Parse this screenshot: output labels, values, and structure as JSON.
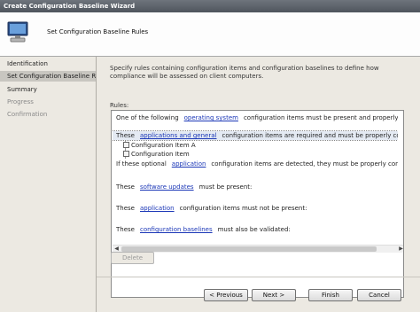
{
  "window": {
    "title": "Create Configuration Baseline Wizard"
  },
  "header": {
    "title": "Set Configuration Baseline Rules",
    "icon": "computer-icon"
  },
  "nav": {
    "items": [
      {
        "label": "Identification",
        "state": "normal"
      },
      {
        "label": "Set Configuration Baseline Rules",
        "state": "active"
      },
      {
        "label": "Summary",
        "state": "normal"
      },
      {
        "label": "Progress",
        "state": "disabled"
      },
      {
        "label": "Confirmation",
        "state": "disabled"
      }
    ]
  },
  "content": {
    "description": "Specify rules containing configuration items and configuration baselines to define how compliance will be assessed on client computers.",
    "rules_label": "Rules:",
    "rules": {
      "r1": {
        "pre": "One of the following",
        "link": "operating system",
        "post": "configuration items must be present and properly configu"
      },
      "r2": {
        "pre": "These",
        "link": "applications and general",
        "post": "configuration items are required and must be properly configured"
      },
      "r2_items": [
        "Configuration Item A",
        "Configuration Item"
      ],
      "r3": {
        "pre": "If these optional",
        "link": "application",
        "post": "configuration items are detected, they must be properly configured:"
      },
      "r4": {
        "pre": "These",
        "link": "software updates",
        "post": "must be present:"
      },
      "r5": {
        "pre": "These",
        "link": "application",
        "post": "configuration items must not be present:"
      },
      "r6": {
        "pre": "These",
        "link": "configuration baselines",
        "post": "must also be validated:"
      }
    },
    "delete_label": "Delete"
  },
  "footer": {
    "previous_label": "< Previous",
    "next_label": "Next >",
    "finish_label": "Finish",
    "cancel_label": "Cancel"
  }
}
